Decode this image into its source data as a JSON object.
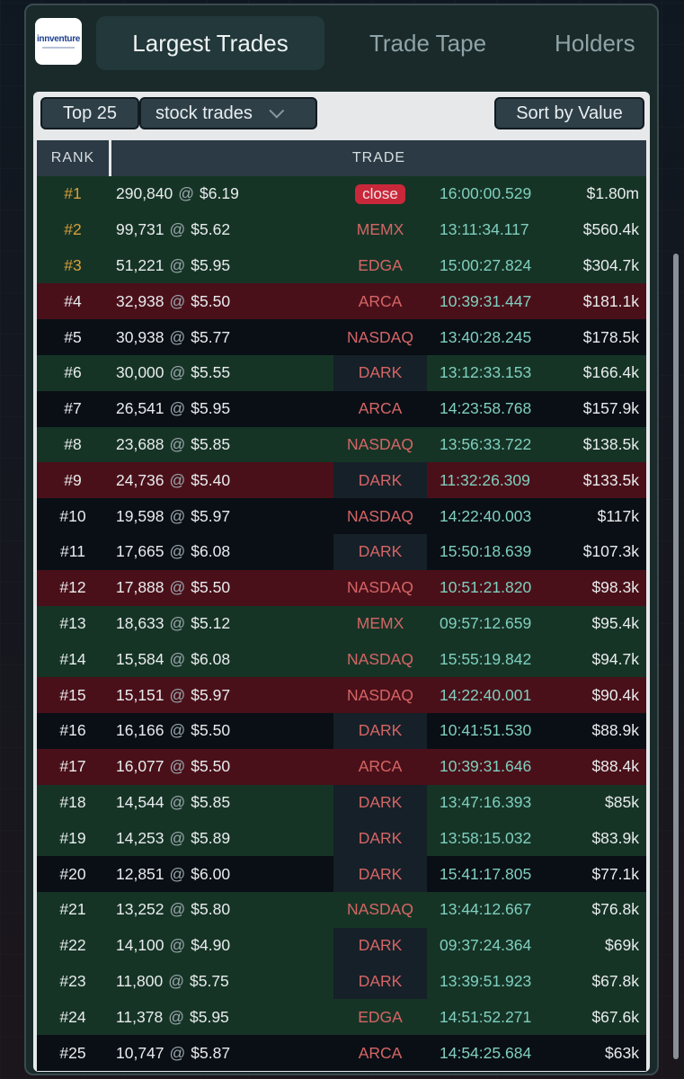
{
  "logo": {
    "text": "innventure"
  },
  "tabs": [
    {
      "label": "Largest Trades",
      "active": true
    },
    {
      "label": "Trade Tape",
      "active": false
    },
    {
      "label": "Holders",
      "active": false
    }
  ],
  "controls": {
    "count_label": "Top 25",
    "type_select": "stock trades",
    "sort_label": "Sort by Value"
  },
  "table": {
    "headers": {
      "rank": "RANK",
      "trade": "TRADE"
    },
    "rows": [
      {
        "rank": "#1",
        "size": "290,840",
        "price": "$6.19",
        "venue": "close",
        "time": "16:00:00.529",
        "value": "$1.80m",
        "color": "green",
        "top": true
      },
      {
        "rank": "#2",
        "size": "99,731",
        "price": "$5.62",
        "venue": "MEMX",
        "time": "13:11:34.117",
        "value": "$560.4k",
        "color": "green",
        "top": true
      },
      {
        "rank": "#3",
        "size": "51,221",
        "price": "$5.95",
        "venue": "EDGA",
        "time": "15:00:27.824",
        "value": "$304.7k",
        "color": "green",
        "top": true
      },
      {
        "rank": "#4",
        "size": "32,938",
        "price": "$5.50",
        "venue": "ARCA",
        "time": "10:39:31.447",
        "value": "$181.1k",
        "color": "red"
      },
      {
        "rank": "#5",
        "size": "30,938",
        "price": "$5.77",
        "venue": "NASDAQ",
        "time": "13:40:28.245",
        "value": "$178.5k",
        "color": "black"
      },
      {
        "rank": "#6",
        "size": "30,000",
        "price": "$5.55",
        "venue": "DARK",
        "time": "13:12:33.153",
        "value": "$166.4k",
        "color": "green"
      },
      {
        "rank": "#7",
        "size": "26,541",
        "price": "$5.95",
        "venue": "ARCA",
        "time": "14:23:58.768",
        "value": "$157.9k",
        "color": "black"
      },
      {
        "rank": "#8",
        "size": "23,688",
        "price": "$5.85",
        "venue": "NASDAQ",
        "time": "13:56:33.722",
        "value": "$138.5k",
        "color": "green"
      },
      {
        "rank": "#9",
        "size": "24,736",
        "price": "$5.40",
        "venue": "DARK",
        "time": "11:32:26.309",
        "value": "$133.5k",
        "color": "red"
      },
      {
        "rank": "#10",
        "size": "19,598",
        "price": "$5.97",
        "venue": "NASDAQ",
        "time": "14:22:40.003",
        "value": "$117k",
        "color": "black"
      },
      {
        "rank": "#11",
        "size": "17,665",
        "price": "$6.08",
        "venue": "DARK",
        "time": "15:50:18.639",
        "value": "$107.3k",
        "color": "black"
      },
      {
        "rank": "#12",
        "size": "17,888",
        "price": "$5.50",
        "venue": "NASDAQ",
        "time": "10:51:21.820",
        "value": "$98.3k",
        "color": "red"
      },
      {
        "rank": "#13",
        "size": "18,633",
        "price": "$5.12",
        "venue": "MEMX",
        "time": "09:57:12.659",
        "value": "$95.4k",
        "color": "green"
      },
      {
        "rank": "#14",
        "size": "15,584",
        "price": "$6.08",
        "venue": "NASDAQ",
        "time": "15:55:19.842",
        "value": "$94.7k",
        "color": "green"
      },
      {
        "rank": "#15",
        "size": "15,151",
        "price": "$5.97",
        "venue": "NASDAQ",
        "time": "14:22:40.001",
        "value": "$90.4k",
        "color": "red"
      },
      {
        "rank": "#16",
        "size": "16,166",
        "price": "$5.50",
        "venue": "DARK",
        "time": "10:41:51.530",
        "value": "$88.9k",
        "color": "black"
      },
      {
        "rank": "#17",
        "size": "16,077",
        "price": "$5.50",
        "venue": "ARCA",
        "time": "10:39:31.646",
        "value": "$88.4k",
        "color": "red"
      },
      {
        "rank": "#18",
        "size": "14,544",
        "price": "$5.85",
        "venue": "DARK",
        "time": "13:47:16.393",
        "value": "$85k",
        "color": "green"
      },
      {
        "rank": "#19",
        "size": "14,253",
        "price": "$5.89",
        "venue": "DARK",
        "time": "13:58:15.032",
        "value": "$83.9k",
        "color": "green"
      },
      {
        "rank": "#20",
        "size": "12,851",
        "price": "$6.00",
        "venue": "DARK",
        "time": "15:41:17.805",
        "value": "$77.1k",
        "color": "black"
      },
      {
        "rank": "#21",
        "size": "13,252",
        "price": "$5.80",
        "venue": "NASDAQ",
        "time": "13:44:12.667",
        "value": "$76.8k",
        "color": "green"
      },
      {
        "rank": "#22",
        "size": "14,100",
        "price": "$4.90",
        "venue": "DARK",
        "time": "09:37:24.364",
        "value": "$69k",
        "color": "green"
      },
      {
        "rank": "#23",
        "size": "11,800",
        "price": "$5.75",
        "venue": "DARK",
        "time": "13:39:51.923",
        "value": "$67.8k",
        "color": "green"
      },
      {
        "rank": "#24",
        "size": "11,378",
        "price": "$5.95",
        "venue": "EDGA",
        "time": "14:51:52.271",
        "value": "$67.6k",
        "color": "green"
      },
      {
        "rank": "#25",
        "size": "10,747",
        "price": "$5.87",
        "venue": "ARCA",
        "time": "14:54:25.684",
        "value": "$63k",
        "color": "black"
      }
    ]
  },
  "colors": {
    "row_green": "#163426",
    "row_red": "#4a1019",
    "row_black": "#0a0f16",
    "rank_gold": "#d8a03a",
    "venue_red": "#d56565",
    "time_teal": "#7fcfbf"
  }
}
